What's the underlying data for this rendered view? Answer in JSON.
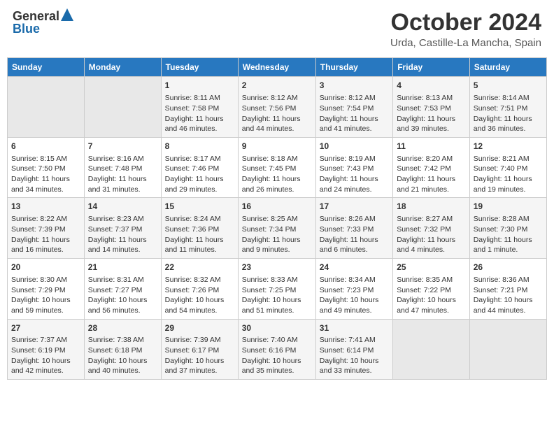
{
  "logo": {
    "general": "General",
    "blue": "Blue"
  },
  "title": "October 2024",
  "location": "Urda, Castille-La Mancha, Spain",
  "days_of_week": [
    "Sunday",
    "Monday",
    "Tuesday",
    "Wednesday",
    "Thursday",
    "Friday",
    "Saturday"
  ],
  "weeks": [
    [
      {
        "day": "",
        "info": ""
      },
      {
        "day": "",
        "info": ""
      },
      {
        "day": "1",
        "info": "Sunrise: 8:11 AM\nSunset: 7:58 PM\nDaylight: 11 hours and 46 minutes."
      },
      {
        "day": "2",
        "info": "Sunrise: 8:12 AM\nSunset: 7:56 PM\nDaylight: 11 hours and 44 minutes."
      },
      {
        "day": "3",
        "info": "Sunrise: 8:12 AM\nSunset: 7:54 PM\nDaylight: 11 hours and 41 minutes."
      },
      {
        "day": "4",
        "info": "Sunrise: 8:13 AM\nSunset: 7:53 PM\nDaylight: 11 hours and 39 minutes."
      },
      {
        "day": "5",
        "info": "Sunrise: 8:14 AM\nSunset: 7:51 PM\nDaylight: 11 hours and 36 minutes."
      }
    ],
    [
      {
        "day": "6",
        "info": "Sunrise: 8:15 AM\nSunset: 7:50 PM\nDaylight: 11 hours and 34 minutes."
      },
      {
        "day": "7",
        "info": "Sunrise: 8:16 AM\nSunset: 7:48 PM\nDaylight: 11 hours and 31 minutes."
      },
      {
        "day": "8",
        "info": "Sunrise: 8:17 AM\nSunset: 7:46 PM\nDaylight: 11 hours and 29 minutes."
      },
      {
        "day": "9",
        "info": "Sunrise: 8:18 AM\nSunset: 7:45 PM\nDaylight: 11 hours and 26 minutes."
      },
      {
        "day": "10",
        "info": "Sunrise: 8:19 AM\nSunset: 7:43 PM\nDaylight: 11 hours and 24 minutes."
      },
      {
        "day": "11",
        "info": "Sunrise: 8:20 AM\nSunset: 7:42 PM\nDaylight: 11 hours and 21 minutes."
      },
      {
        "day": "12",
        "info": "Sunrise: 8:21 AM\nSunset: 7:40 PM\nDaylight: 11 hours and 19 minutes."
      }
    ],
    [
      {
        "day": "13",
        "info": "Sunrise: 8:22 AM\nSunset: 7:39 PM\nDaylight: 11 hours and 16 minutes."
      },
      {
        "day": "14",
        "info": "Sunrise: 8:23 AM\nSunset: 7:37 PM\nDaylight: 11 hours and 14 minutes."
      },
      {
        "day": "15",
        "info": "Sunrise: 8:24 AM\nSunset: 7:36 PM\nDaylight: 11 hours and 11 minutes."
      },
      {
        "day": "16",
        "info": "Sunrise: 8:25 AM\nSunset: 7:34 PM\nDaylight: 11 hours and 9 minutes."
      },
      {
        "day": "17",
        "info": "Sunrise: 8:26 AM\nSunset: 7:33 PM\nDaylight: 11 hours and 6 minutes."
      },
      {
        "day": "18",
        "info": "Sunrise: 8:27 AM\nSunset: 7:32 PM\nDaylight: 11 hours and 4 minutes."
      },
      {
        "day": "19",
        "info": "Sunrise: 8:28 AM\nSunset: 7:30 PM\nDaylight: 11 hours and 1 minute."
      }
    ],
    [
      {
        "day": "20",
        "info": "Sunrise: 8:30 AM\nSunset: 7:29 PM\nDaylight: 10 hours and 59 minutes."
      },
      {
        "day": "21",
        "info": "Sunrise: 8:31 AM\nSunset: 7:27 PM\nDaylight: 10 hours and 56 minutes."
      },
      {
        "day": "22",
        "info": "Sunrise: 8:32 AM\nSunset: 7:26 PM\nDaylight: 10 hours and 54 minutes."
      },
      {
        "day": "23",
        "info": "Sunrise: 8:33 AM\nSunset: 7:25 PM\nDaylight: 10 hours and 51 minutes."
      },
      {
        "day": "24",
        "info": "Sunrise: 8:34 AM\nSunset: 7:23 PM\nDaylight: 10 hours and 49 minutes."
      },
      {
        "day": "25",
        "info": "Sunrise: 8:35 AM\nSunset: 7:22 PM\nDaylight: 10 hours and 47 minutes."
      },
      {
        "day": "26",
        "info": "Sunrise: 8:36 AM\nSunset: 7:21 PM\nDaylight: 10 hours and 44 minutes."
      }
    ],
    [
      {
        "day": "27",
        "info": "Sunrise: 7:37 AM\nSunset: 6:19 PM\nDaylight: 10 hours and 42 minutes."
      },
      {
        "day": "28",
        "info": "Sunrise: 7:38 AM\nSunset: 6:18 PM\nDaylight: 10 hours and 40 minutes."
      },
      {
        "day": "29",
        "info": "Sunrise: 7:39 AM\nSunset: 6:17 PM\nDaylight: 10 hours and 37 minutes."
      },
      {
        "day": "30",
        "info": "Sunrise: 7:40 AM\nSunset: 6:16 PM\nDaylight: 10 hours and 35 minutes."
      },
      {
        "day": "31",
        "info": "Sunrise: 7:41 AM\nSunset: 6:14 PM\nDaylight: 10 hours and 33 minutes."
      },
      {
        "day": "",
        "info": ""
      },
      {
        "day": "",
        "info": ""
      }
    ]
  ]
}
